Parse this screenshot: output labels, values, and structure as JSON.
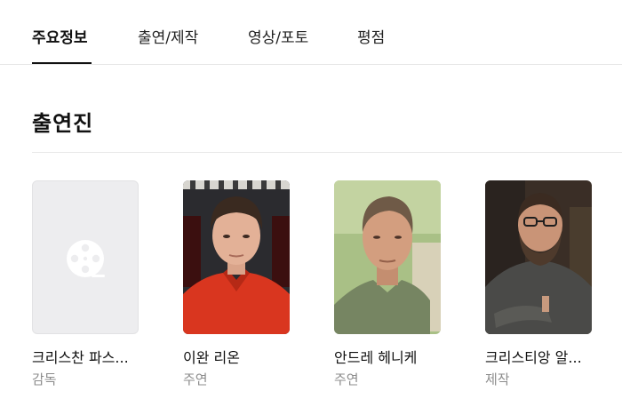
{
  "tabs": [
    {
      "label": "주요정보",
      "active": true
    },
    {
      "label": "출연/제작",
      "active": false
    },
    {
      "label": "영상/포토",
      "active": false
    },
    {
      "label": "평점",
      "active": false
    }
  ],
  "section": {
    "title": "출연진"
  },
  "cast": [
    {
      "name": "크리스찬 파스...",
      "role": "감독",
      "photo": "placeholder-film-icon"
    },
    {
      "name": "이완 리온",
      "role": "주연",
      "photo": "portrait"
    },
    {
      "name": "안드레 헤니케",
      "role": "주연",
      "photo": "portrait"
    },
    {
      "name": "크리스티앙 알...",
      "role": "제작",
      "photo": "portrait"
    }
  ],
  "colors": {
    "text": "#111111",
    "muted": "#8c8c8c",
    "placeholder_bg": "#ededef",
    "divider": "#e6e6e6"
  }
}
